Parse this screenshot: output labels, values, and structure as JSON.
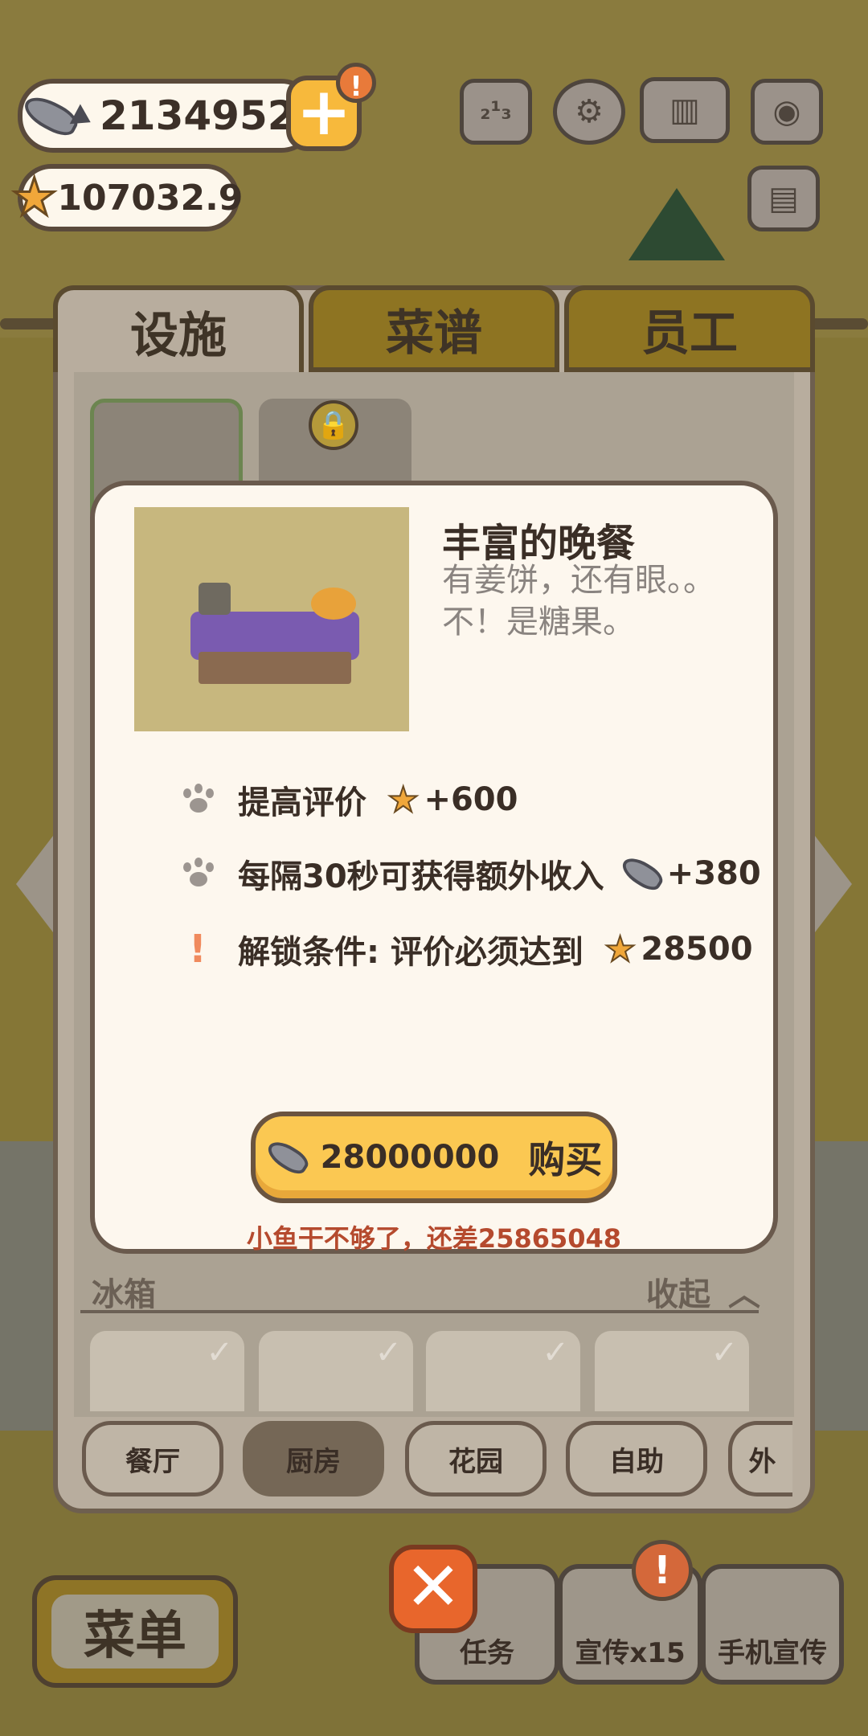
{
  "currency": {
    "fish": "2134952",
    "stars": "107032.9",
    "plus_alert": "!"
  },
  "top_icons": {
    "ranking": "₂¹₃"
  },
  "tabs": [
    {
      "label": "设施",
      "active": true
    },
    {
      "label": "菜谱",
      "active": false
    },
    {
      "label": "员工",
      "active": false
    }
  ],
  "item": {
    "title": "丰富的晚餐",
    "description": "有姜饼，还有眼。。不！是糖果。",
    "stats": {
      "rating_label": "提高评价",
      "rating_value": "+600",
      "income_label": "每隔30秒可获得额外收入",
      "income_value": "+380",
      "unlock_label": "解锁条件: 评价必须达到",
      "unlock_value": "28500"
    },
    "buy_price": "28000000",
    "buy_label": "购买",
    "warning": "小鱼干不够了，还差25865048"
  },
  "section": {
    "title": "冰箱",
    "collapse_label": "收起"
  },
  "categories": [
    "餐厅",
    "厨房",
    "花园",
    "自助",
    "外"
  ],
  "active_category": "厨房",
  "bottom": {
    "menu": "菜单",
    "tasks": "任务",
    "promote": "宣传x15",
    "phone_promote": "手机宣传",
    "promote_alert": "!"
  },
  "colors": {
    "accent": "#fbc852",
    "close": "#e8662c",
    "warning": "#b54a2e",
    "star": "#f0a73a"
  }
}
